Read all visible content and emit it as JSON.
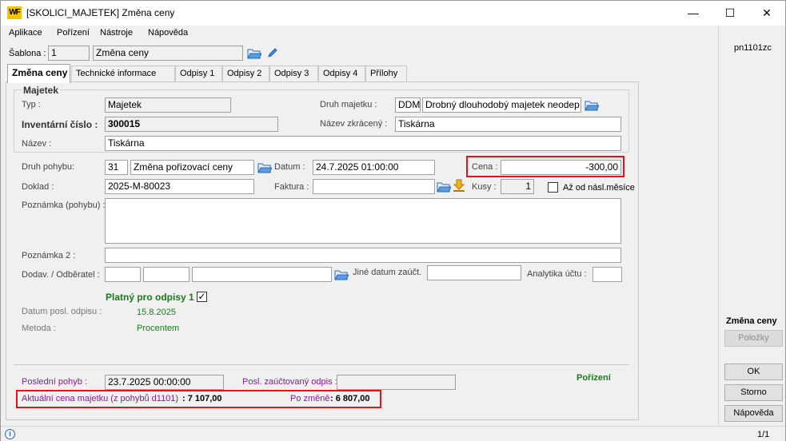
{
  "window": {
    "title": "[SKOLICI_MAJETEK] Změna ceny",
    "logo_text": "WF",
    "minimize_glyph": "—",
    "maximize_glyph": "☐",
    "close_glyph": "✕"
  },
  "menu": [
    "Aplikace",
    "Pořízení",
    "Nástroje",
    "Nápověda"
  ],
  "template": {
    "label": "Šablona :",
    "number": "1",
    "name": "Změna ceny"
  },
  "tabs": [
    "Změna ceny",
    "Technické informace",
    "Odpisy 1",
    "Odpisy 2",
    "Odpisy 3",
    "Odpisy 4",
    "Přílohy"
  ],
  "asset": {
    "group_title": "Majetek",
    "type_label": "Typ :",
    "type_value": "Majetek",
    "inventory_label": "Inventární číslo :",
    "inventory_value": "300015",
    "name_label": "Název :",
    "name_value": "Tiskárna",
    "kind_label": "Druh majetku :",
    "kind_code": "DDM",
    "kind_name": "Drobný dlouhodobý majetek neodep",
    "short_name_label": "Název zkrácený :",
    "short_name_value": "Tiskárna"
  },
  "movement": {
    "kind_label": "Druh pohybu:",
    "kind_code": "31",
    "kind_name": "Změna pořizovací ceny",
    "date_label": "Datum :",
    "date_value": "24.7.2025 01:00:00",
    "price_label": "Cena :",
    "price_value": "-300,00",
    "doc_label": "Doklad :",
    "doc_value": "2025-M-80023",
    "invoice_label": "Faktura :",
    "invoice_value": "",
    "qty_label": "Kusy :",
    "qty_value": "1",
    "from_next_month_label": "Až od násl.měsíce",
    "note_label": "Poznámka (pohybu) :",
    "note_value": "",
    "note2_label": "Poznámka 2 :",
    "note2_value": "",
    "supplier_label": "Dodav. / Odběratel :",
    "other_date_label": "Jiné datum zaúčt.",
    "analytics_label": "Analytika účtu :",
    "valid_label": "Platný pro odpisy 1",
    "last_dep_date_label": "Datum posl. odpisu :",
    "last_dep_date_value": "15.8.2025",
    "method_label": "Metoda :",
    "method_value": "Procentem"
  },
  "summary": {
    "last_move_label": "Poslední pohyb :",
    "last_move_value": "23.7.2025 00:00:00",
    "last_posted_label": "Posl. zaúčtovaný odpis :",
    "last_posted_value": "",
    "acquisition_label": "Pořízení",
    "current_price_label": "Aktuální cena majetku  (z pohybů d1101)",
    "current_price_value": ": 7 107,00",
    "after_change_label": "Po změně",
    "after_change_value": ": 6 807,00"
  },
  "right_panel": {
    "code": "pn1101zc",
    "section_title": "Změna ceny",
    "items_button": "Položky",
    "ok_button": "OK",
    "cancel_button": "Storno",
    "help_button": "Nápověda"
  },
  "status": {
    "page": "1/1",
    "info_glyph": "i"
  },
  "colors": {
    "highlight_red": "#e3121b",
    "label_purple": "#8a1c8a",
    "label_green": "#1b7a1b"
  }
}
